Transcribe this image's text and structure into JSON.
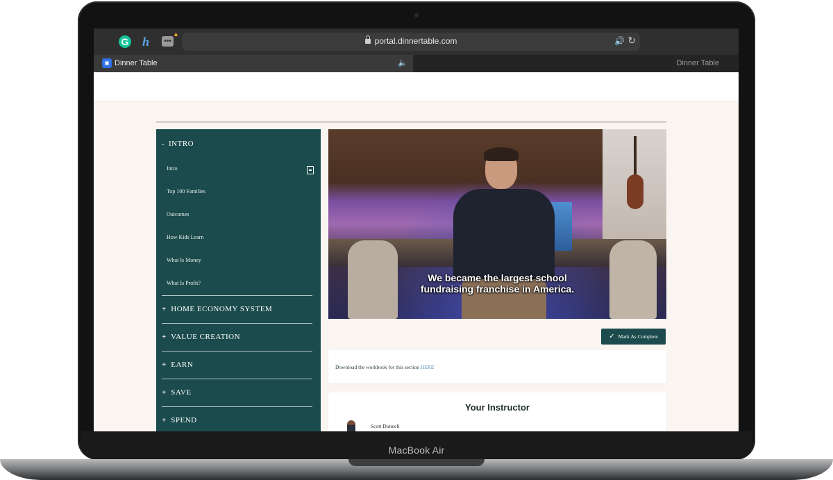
{
  "device": {
    "label": "MacBook Air"
  },
  "browser": {
    "url": "portal.dinnertable.com",
    "tabs": [
      {
        "label": "Dinner Table",
        "active": true
      },
      {
        "label": "Dinner Table",
        "active": false
      }
    ],
    "extensions": [
      {
        "name": "grammarly-icon",
        "glyph": "G"
      },
      {
        "name": "honey-icon",
        "glyph": "h"
      },
      {
        "name": "more-extensions-icon",
        "glyph": "•••"
      }
    ]
  },
  "sidebar": {
    "sections": [
      {
        "sign": "-",
        "label": "INTRO",
        "expanded": true,
        "lessons": [
          "Intro",
          "Top 100 Families",
          "Outcomes",
          "How Kids Learn",
          "What Is Money",
          "What Is Profit?"
        ]
      },
      {
        "sign": "+",
        "label": "HOME ECONOMY SYSTEM"
      },
      {
        "sign": "+",
        "label": "VALUE CREATION"
      },
      {
        "sign": "+",
        "label": "EARN"
      },
      {
        "sign": "+",
        "label": "SAVE"
      },
      {
        "sign": "+",
        "label": "SPEND"
      }
    ]
  },
  "video": {
    "caption_line1": "We became the largest school",
    "caption_line2": "fundraising franchise in America."
  },
  "actions": {
    "mark_complete": "Mark As Complete"
  },
  "workbook": {
    "text": "Download the workbook for this section ",
    "link": "HERE"
  },
  "instructor": {
    "title": "Your Instructor",
    "name": "Scott Donnell"
  },
  "colors": {
    "sidebar_bg": "#1b4b4c",
    "page_bg": "#fbf5f2",
    "link": "#4c8bb8"
  }
}
